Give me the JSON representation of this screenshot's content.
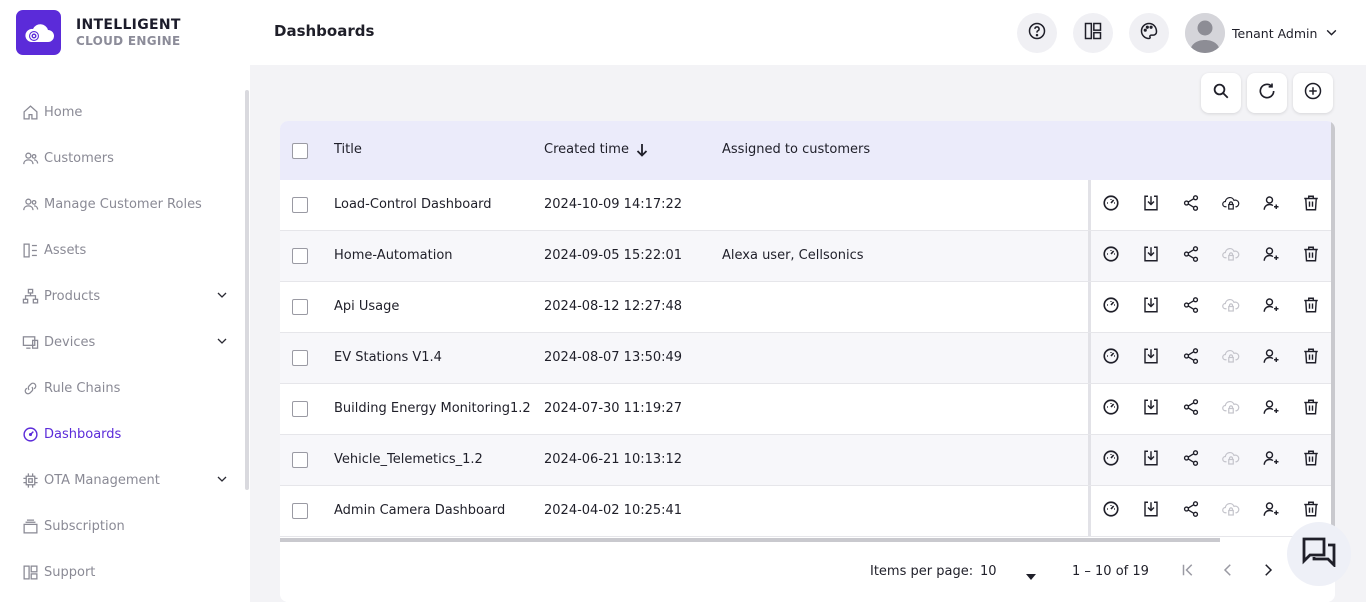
{
  "brand": {
    "line1": "INTELLIGENT",
    "line2": "CLOUD ENGINE",
    "color": "#5b2bd9"
  },
  "sidebar": {
    "items": [
      {
        "label": "Home",
        "icon": "home-icon"
      },
      {
        "label": "Customers",
        "icon": "users-icon"
      },
      {
        "label": "Manage Customer Roles",
        "icon": "users-icon"
      },
      {
        "label": "Assets",
        "icon": "assets-icon"
      },
      {
        "label": "Products",
        "icon": "hierarchy-icon",
        "expandable": true
      },
      {
        "label": "Devices",
        "icon": "devices-icon",
        "expandable": true
      },
      {
        "label": "Rule Chains",
        "icon": "link-icon"
      },
      {
        "label": "Dashboards",
        "icon": "gauge-icon",
        "active": true
      },
      {
        "label": "OTA Management",
        "icon": "chip-icon",
        "expandable": true
      },
      {
        "label": "Subscription",
        "icon": "subscription-icon"
      },
      {
        "label": "Support",
        "icon": "support-icon"
      }
    ]
  },
  "header": {
    "title": "Dashboards",
    "user_name": "Tenant Admin"
  },
  "table": {
    "columns": {
      "title": "Title",
      "created": "Created time",
      "customers": "Assigned to customers"
    },
    "rows": [
      {
        "title": "Load-Control Dashboard",
        "created": "2024-10-09 14:17:22",
        "customers": ""
      },
      {
        "title": "Home-Automation",
        "created": "2024-09-05 15:22:01",
        "customers": "Alexa user, Cellsonics"
      },
      {
        "title": "Api Usage",
        "created": "2024-08-12 12:27:48",
        "customers": ""
      },
      {
        "title": "EV Stations V1.4",
        "created": "2024-08-07 13:50:49",
        "customers": ""
      },
      {
        "title": "Building Energy Monitoring1.2",
        "created": "2024-07-30 11:19:27",
        "customers": ""
      },
      {
        "title": "Vehicle_Telemetics_1.2",
        "created": "2024-06-21 10:13:12",
        "customers": ""
      },
      {
        "title": "Admin Camera Dashboard",
        "created": "2024-04-02 10:25:41",
        "customers": ""
      }
    ]
  },
  "pagination": {
    "items_per_page_label": "Items per page:",
    "items_per_page": "10",
    "range": "1 – 10 of 19"
  }
}
